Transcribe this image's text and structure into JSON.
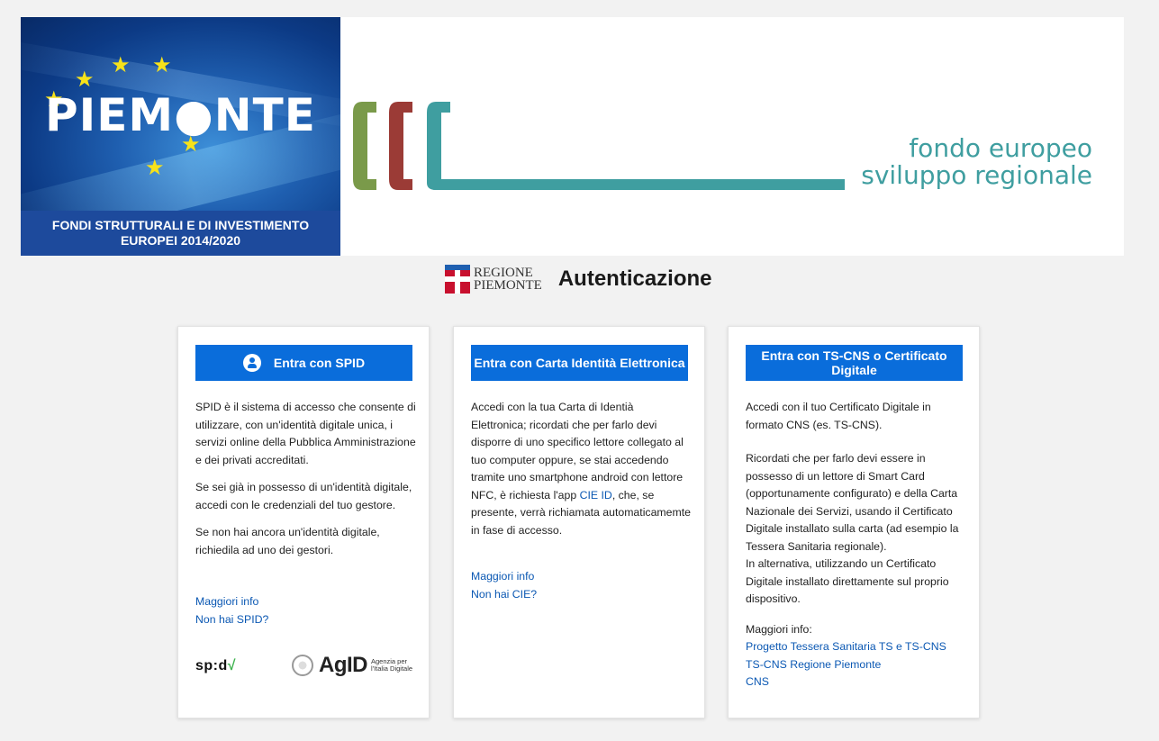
{
  "banner": {
    "piemonte_word": "PIEM●NTE",
    "piemonte_strip_line1": "FONDI STRUTTURALI E DI INVESTIMENTO",
    "piemonte_strip_line2": "EUROPEI 2014/2020",
    "fesr_line1": "fondo europeo",
    "fesr_line2": "sviluppo regionale",
    "colors": {
      "green": "#7a9a4a",
      "red": "#9b3b36",
      "teal": "#3f9ea0"
    }
  },
  "header": {
    "region_line1": "REGIONE",
    "region_line2": "PIEMONTE",
    "title": "Autenticazione"
  },
  "spid": {
    "button_label": "Entra con SPID",
    "p1": "SPID è il sistema di accesso che consente di utilizzare, con un'identità digitale unica, i servizi online della Pubblica Amministrazione e dei privati accreditati.",
    "p2": "Se sei già in possesso di un'identità digitale, accedi con le credenziali del tuo gestore.",
    "p3": "Se non hai ancora un'identità digitale, richiedila ad uno dei gestori.",
    "link_info": "Maggiori info",
    "link_no_spid": "Non hai SPID?",
    "spid_logo_a": "sp",
    "spid_logo_b": ":d",
    "spid_logo_check": "√",
    "agid_word": "AgID",
    "agid_small1": "Agenzia per",
    "agid_small2": "l'Italia Digitale"
  },
  "cie": {
    "button_label": "Entra con Carta Identità Elettronica",
    "p1_before": "Accedi con la tua Carta di Identià Elettronica; ricordati che per farlo devi disporre di uno specifico lettore collegato al tuo computer oppure, se stai accedendo tramite uno smartphone android con lettore NFC, è richiesta l'app ",
    "p1_link": "CIE ID",
    "p1_after": ", che, se presente, verrà richiamata automaticamemte in fase di accesso.",
    "link_info": "Maggiori info",
    "link_no_cie": "Non hai CIE?"
  },
  "cns": {
    "button_label": "Entra con TS-CNS o Certificato Digitale",
    "p1": "Accedi con il tuo Certificato Digitale in formato CNS (es. TS-CNS).",
    "p2": "Ricordati che per farlo devi essere in possesso di un lettore di Smart Card (opportunamente configurato) e della Carta Nazionale dei Servizi, usando il Certificato Digitale installato sulla carta (ad esempio la Tessera Sanitaria regionale).",
    "p3": "In alternativa, utilizzando un Certificato Digitale installato direttamente sul proprio dispositivo.",
    "more_label": "Maggiori info:",
    "link1": "Progetto Tessera Sanitaria TS e TS-CNS",
    "link2": "TS-CNS Regione Piemonte",
    "link3": "CNS"
  },
  "colors": {
    "button_blue": "#0a6ddb",
    "link_blue": "#0b58b3"
  }
}
